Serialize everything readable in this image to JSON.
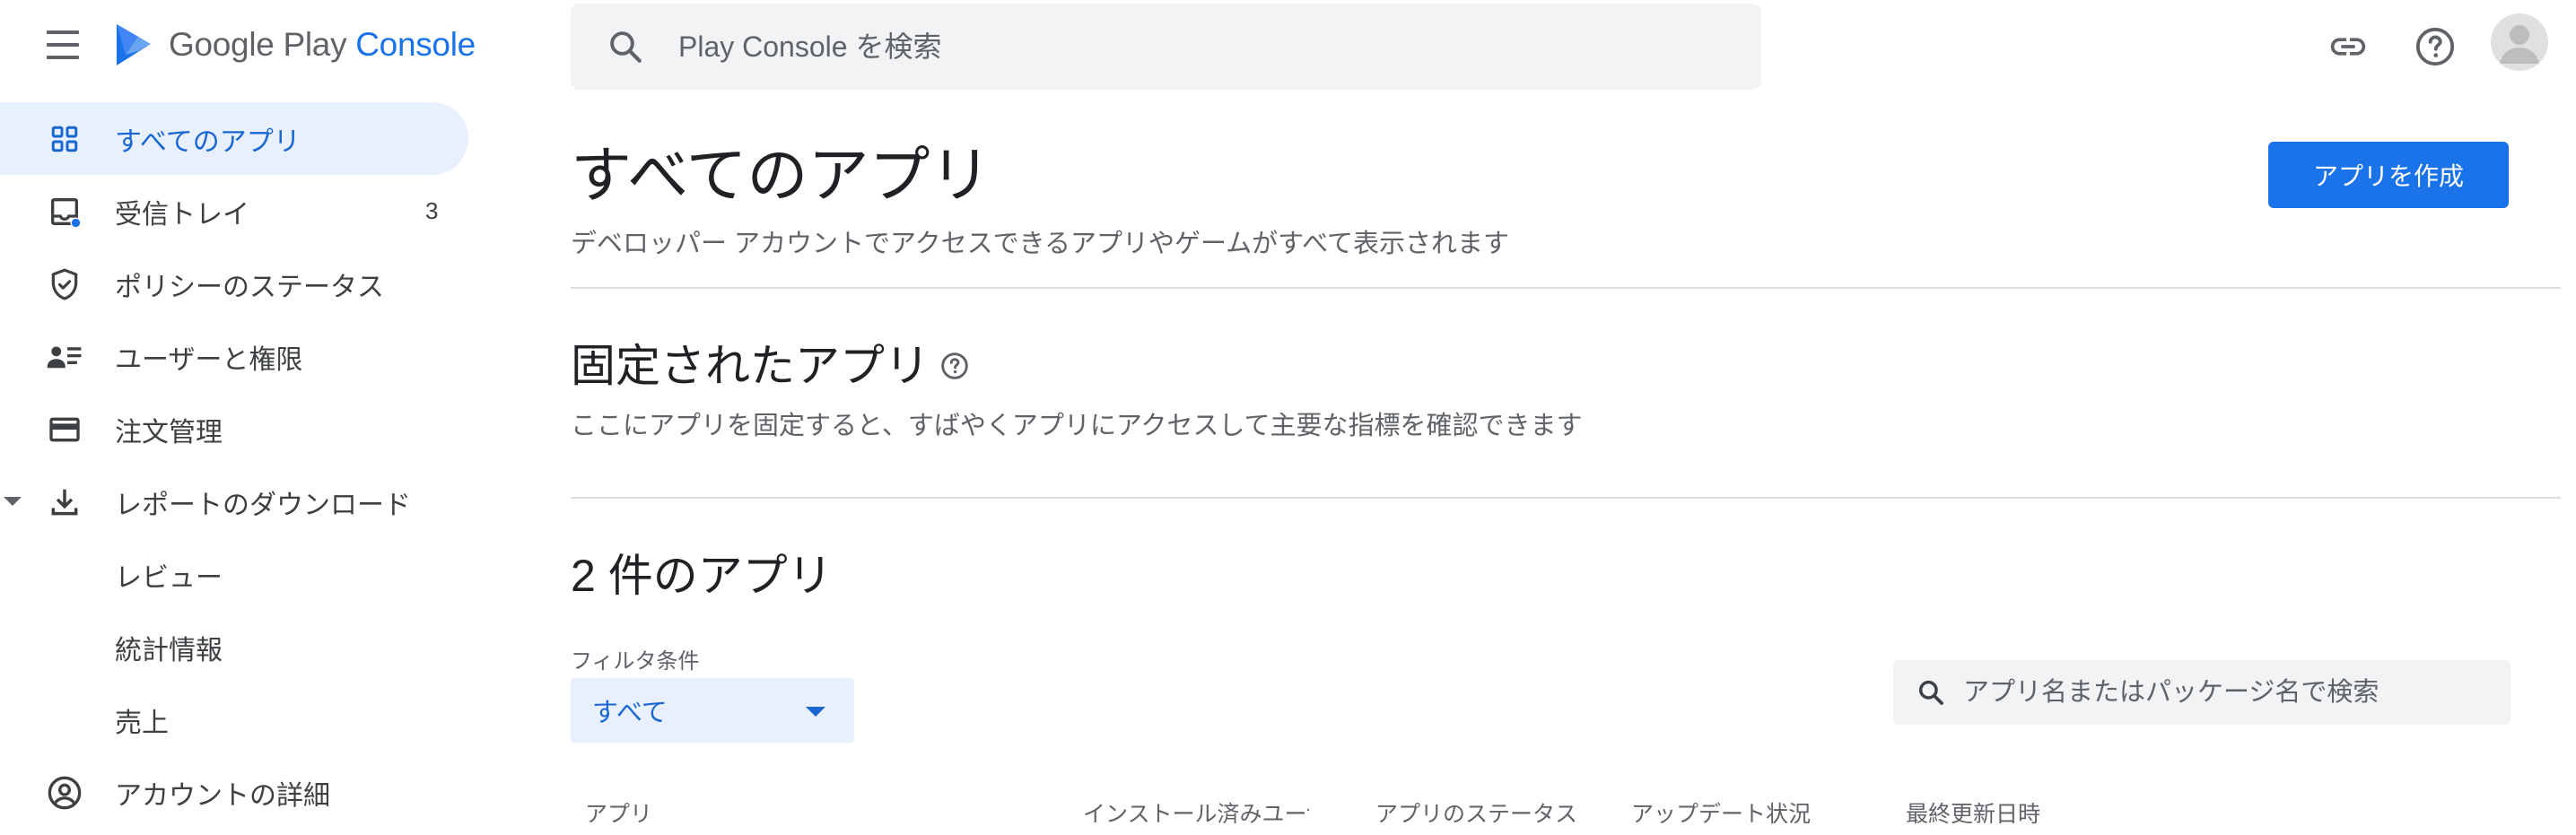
{
  "header": {
    "logo_text_main": "Google Play ",
    "logo_text_accent": "Console",
    "search_placeholder": "Play Console を検索",
    "icons": [
      "menu-icon",
      "link-icon",
      "help-icon",
      "account-icon"
    ]
  },
  "sidebar": {
    "items": [
      {
        "label": "すべてのアプリ",
        "icon": "grid-icon",
        "active": true
      },
      {
        "label": "受信トレイ",
        "icon": "inbox-icon",
        "count": "3"
      },
      {
        "label": "ポリシーのステータス",
        "icon": "shield-check-icon"
      },
      {
        "label": "ユーザーと権限",
        "icon": "users-icon"
      },
      {
        "label": "注文管理",
        "icon": "credit-card-icon"
      },
      {
        "label": "レポートのダウンロード",
        "icon": "download-icon",
        "expanded": true
      },
      {
        "label": "レビュー",
        "sub": true
      },
      {
        "label": "統計情報",
        "sub": true
      },
      {
        "label": "売上",
        "sub": true
      },
      {
        "label": "アカウントの詳細",
        "icon": "account-circle-icon"
      }
    ]
  },
  "main": {
    "title": "すべてのアプリ",
    "subtitle": "デベロッパー アカウントでアクセスできるアプリやゲームがすべて表示されます",
    "create_button": "アプリを作成",
    "pinned": {
      "title": "固定されたアプリ",
      "description": "ここにアプリを固定すると、すばやくアプリにアクセスして主要な指標を確認できます"
    },
    "apps": {
      "title": "2 件のアプリ",
      "filter_label": "フィルタ条件",
      "filter_value": "すべて",
      "search_placeholder": "アプリ名またはパッケージ名で検索",
      "columns": [
        "アプリ",
        "インストール済みユーザー",
        "アプリのステータス",
        "アップデート状況",
        "最終更新日時"
      ]
    }
  },
  "colors": {
    "accent": "#1a73e8",
    "active_bg": "#e8f0fe",
    "text_secondary": "#5f6368"
  }
}
